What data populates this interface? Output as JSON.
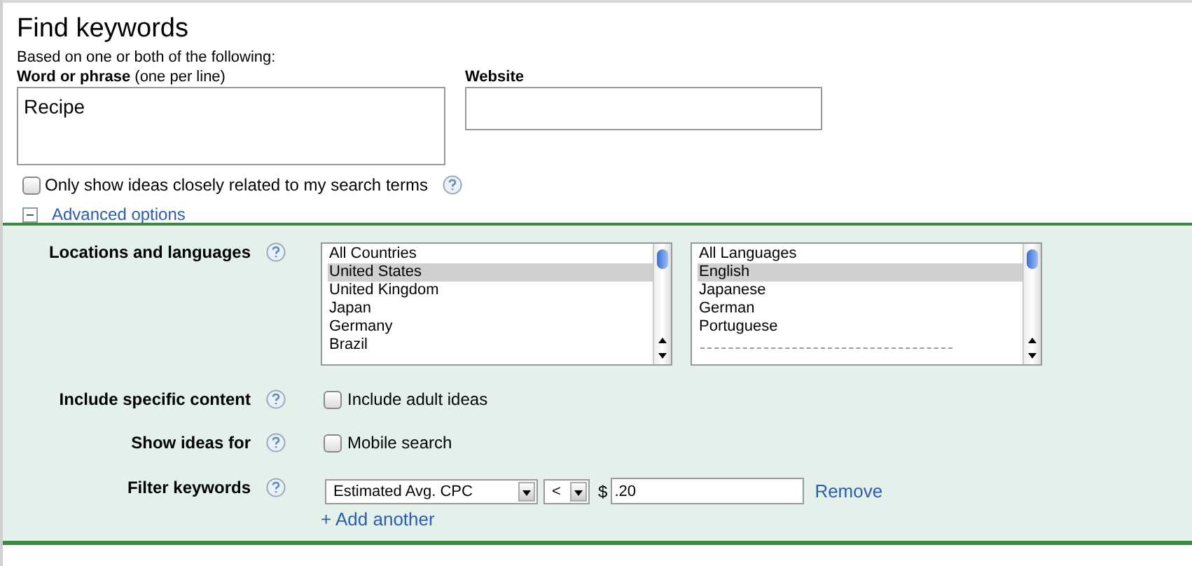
{
  "title": "Find keywords",
  "subtitle": "Based on one or both of the following:",
  "word_field": {
    "label": "**Word or phrase** (one per line)",
    "value": "Recipe"
  },
  "website_field": {
    "label": "Website"
  },
  "closely_related": {
    "label": "Only show ideas closely related to my search terms",
    "checked": false
  },
  "advanced_options": {
    "label": "Advanced options",
    "expanded": true
  },
  "options": [
    {
      "kind": "lists",
      "label": "Locations and languages",
      "lists": [
        {
          "items": [
            {
              "text": "All Countries",
              "selected": false,
              "kind": "item"
            },
            {
              "text": "United States",
              "selected": true,
              "kind": "item"
            },
            {
              "text": "United Kingdom",
              "selected": false,
              "kind": "item"
            },
            {
              "text": "Japan",
              "selected": false,
              "kind": "item"
            },
            {
              "text": "Germany",
              "selected": false,
              "kind": "item"
            },
            {
              "text": "Brazil",
              "selected": false,
              "kind": "item"
            }
          ]
        },
        {
          "items": [
            {
              "text": "All Languages",
              "selected": false,
              "kind": "item"
            },
            {
              "text": "English",
              "selected": true,
              "kind": "item"
            },
            {
              "text": "Japanese",
              "selected": false,
              "kind": "item"
            },
            {
              "text": "German",
              "selected": false,
              "kind": "item"
            },
            {
              "text": "Portuguese",
              "selected": false,
              "kind": "item"
            },
            {
              "kind": "separator"
            }
          ]
        }
      ]
    },
    {
      "kind": "checkbox",
      "label": "Include specific content",
      "text": "Include adult ideas",
      "checked": false
    },
    {
      "kind": "checkbox",
      "label": "Show ideas for",
      "text": "Mobile search",
      "checked": false
    },
    {
      "kind": "filter",
      "label": "Filter keywords",
      "metric": "Estimated Avg. CPC",
      "operator": "<",
      "currency": "$",
      "value": ".20",
      "remove": "Remove",
      "add": "+ Add another"
    }
  ]
}
